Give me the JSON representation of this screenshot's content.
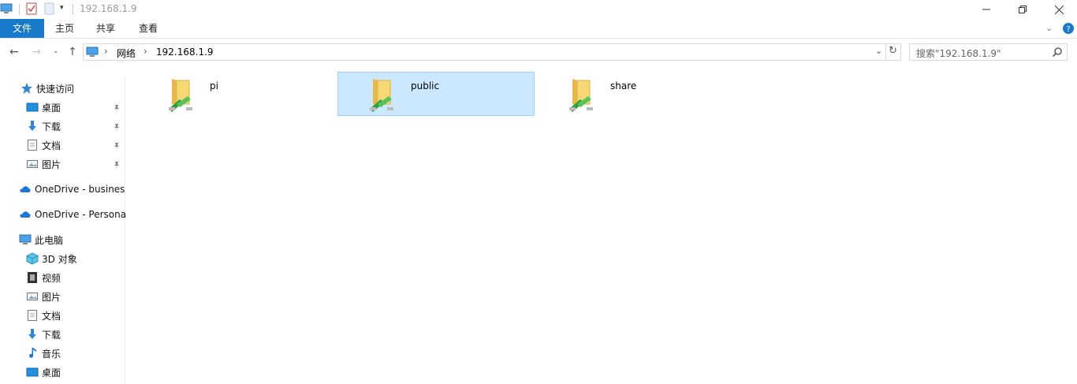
{
  "window": {
    "title": "192.168.1.9"
  },
  "ribbon": {
    "tabs": [
      "文件",
      "主页",
      "共享",
      "查看"
    ]
  },
  "address": {
    "path": [
      "网络",
      "192.168.1.9"
    ],
    "search_placeholder": "搜索\"192.168.1.9\""
  },
  "sidebar": {
    "quick_access": "快速访问",
    "quick_items": [
      "桌面",
      "下载",
      "文档",
      "图片"
    ],
    "onedrive_business": "OneDrive - busines",
    "onedrive_personal": "OneDrive - Persona",
    "this_pc": "此电脑",
    "pc_items": [
      "3D 对象",
      "视频",
      "图片",
      "文档",
      "下载",
      "音乐",
      "桌面"
    ]
  },
  "content": {
    "items": [
      {
        "name": "pi",
        "selected": false
      },
      {
        "name": "public",
        "selected": true
      },
      {
        "name": "share",
        "selected": false
      }
    ]
  },
  "colors": {
    "accent": "#1979ca",
    "selection_bg": "#cce8ff",
    "selection_border": "#99d1ff"
  }
}
